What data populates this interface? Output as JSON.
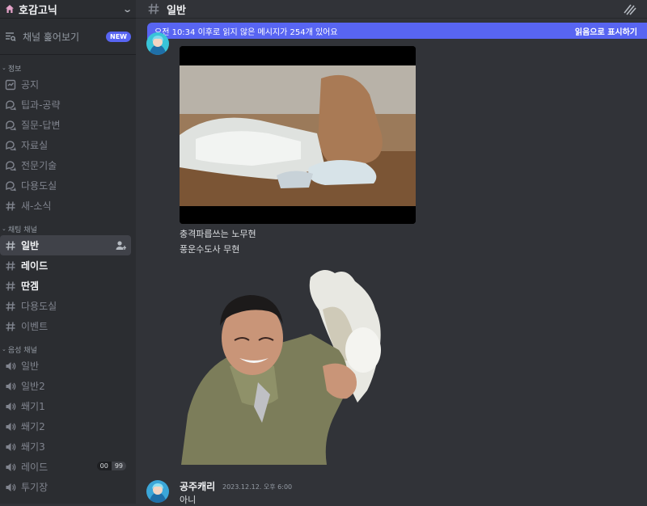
{
  "server": {
    "name": "호감고닉"
  },
  "browse": {
    "label": "채널 훑어보기",
    "badge": "NEW"
  },
  "categories": [
    {
      "name": "정보",
      "channels": [
        {
          "name": "공지",
          "type": "announce"
        },
        {
          "name": "팁과-공략",
          "type": "forum"
        },
        {
          "name": "질문-답변",
          "type": "forum"
        },
        {
          "name": "자료실",
          "type": "forum"
        },
        {
          "name": "전문기술",
          "type": "forum"
        },
        {
          "name": "다용도실",
          "type": "forum"
        },
        {
          "name": "새-소식",
          "type": "text"
        }
      ]
    },
    {
      "name": "채팅 채널",
      "channels": [
        {
          "name": "일반",
          "type": "text",
          "state": "active"
        },
        {
          "name": "레이드",
          "type": "text",
          "state": "unread"
        },
        {
          "name": "딴겜",
          "type": "text",
          "state": "unread"
        },
        {
          "name": "다용도실",
          "type": "text"
        },
        {
          "name": "이벤트",
          "type": "text"
        }
      ]
    },
    {
      "name": "음성 채널",
      "channels": [
        {
          "name": "일반",
          "type": "voice"
        },
        {
          "name": "일반2",
          "type": "voice"
        },
        {
          "name": "쐐기1",
          "type": "voice"
        },
        {
          "name": "쐐기2",
          "type": "voice"
        },
        {
          "name": "쐐기3",
          "type": "voice"
        },
        {
          "name": "레이드",
          "type": "voice",
          "count": "00",
          "limit": "99"
        },
        {
          "name": "투기장",
          "type": "voice"
        }
      ]
    }
  ],
  "topbar": {
    "channel": "일반"
  },
  "newbar": {
    "text": "오전 10:34 이후로 읽지 않은 메시지가 254개 있어요",
    "mark": "읽음으로 표시하기"
  },
  "messages": {
    "caption1": "충격파릅쓰는 노무현",
    "caption2": "풍운수도사 무현",
    "author": "공주캐리",
    "timestamp": "2023.12.12. 오후 6:00",
    "text": "아니"
  },
  "colors": {
    "accent": "#5865f2",
    "sidebar": "#2b2d31",
    "chat": "#313338"
  }
}
